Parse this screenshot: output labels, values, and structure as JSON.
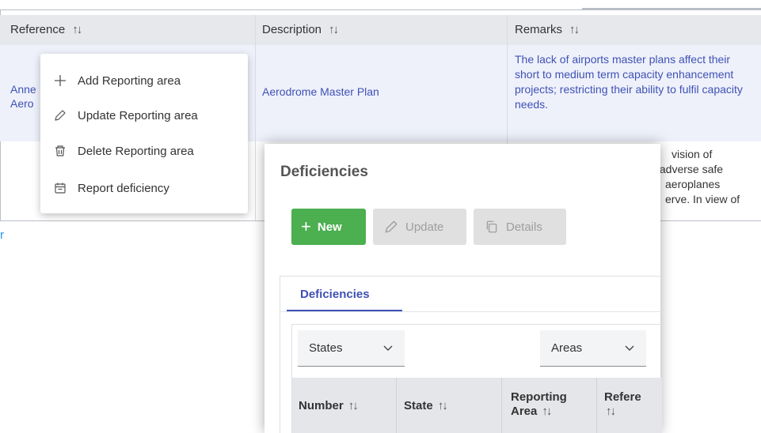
{
  "table": {
    "columns": [
      {
        "label": "Reference",
        "sort": "↑↓"
      },
      {
        "label": "Description",
        "sort": "↑↓"
      },
      {
        "label": "Remarks",
        "sort": "↑↓"
      }
    ],
    "row1": {
      "reference_line1": "Anne",
      "reference_line2": "Aero",
      "description": "Aerodrome Master Plan",
      "remarks": "The lack of airports master plans affect their short to medium term capacity enhancement projects; restricting their ability to fulfil capacity needs."
    },
    "row2": {
      "remarks_lines": [
        "vision of",
        "y adverse safe",
        "aeroplanes",
        "erve. In view of"
      ]
    },
    "stray_link": "r"
  },
  "context_menu": {
    "items": [
      {
        "label": "Add Reporting area",
        "icon": "plus-icon"
      },
      {
        "label": "Update Reporting area",
        "icon": "pencil-icon"
      },
      {
        "label": "Delete Reporting area",
        "icon": "trash-icon"
      },
      {
        "label": "Report deficiency",
        "icon": "calendar-icon"
      }
    ]
  },
  "panel": {
    "title": "Deficiencies",
    "buttons": {
      "new": "New",
      "update": "Update",
      "details": "Details"
    },
    "tab": "Deficiencies",
    "filters": {
      "states": "States",
      "areas": "Areas"
    },
    "columns": [
      {
        "line1": "Number",
        "sort": "↑↓"
      },
      {
        "line1": "State",
        "sort": "↑↓"
      },
      {
        "line1": "Reporting",
        "line2": "Area",
        "sort": "↑↓"
      },
      {
        "line1": "Refere",
        "sort": "↑↓"
      }
    ]
  },
  "colors": {
    "accent": "#3f51b5",
    "primary_button": "#4caf50",
    "disabled_button": "#e0e0e0",
    "link": "#2196f3"
  }
}
